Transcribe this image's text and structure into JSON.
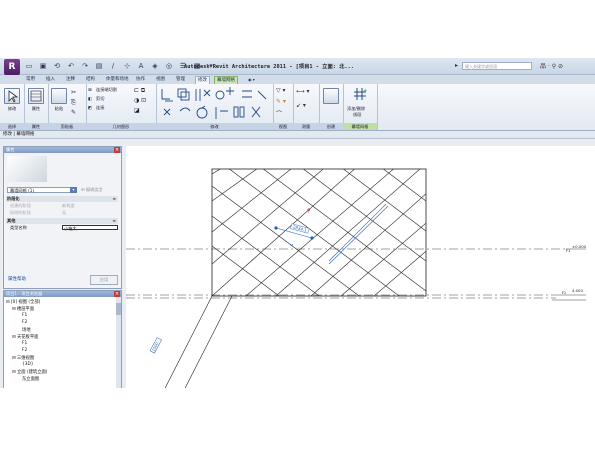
{
  "title": {
    "app_letter": "R",
    "text": "Autodesk Revit Architecture 2011 - [项目1 - 立面: 北...",
    "search_placeholder": "键入关键字或短语",
    "tools": "品 · ⚲ ⊘"
  },
  "tabs": [
    {
      "label": "常用",
      "state": "normal"
    },
    {
      "label": "插入",
      "state": "normal"
    },
    {
      "label": "注释",
      "state": "normal"
    },
    {
      "label": "结构",
      "state": "normal"
    },
    {
      "label": "体量和场地",
      "state": "normal"
    },
    {
      "label": "协作",
      "state": "normal"
    },
    {
      "label": "视图",
      "state": "normal"
    },
    {
      "label": "管理",
      "state": "normal"
    },
    {
      "label": "修改",
      "state": "active"
    },
    {
      "label": "幕墙网格",
      "state": "context"
    }
  ],
  "ribbon": {
    "panels": [
      {
        "title": "选择",
        "buttons": [
          "修改"
        ]
      },
      {
        "title": "属性",
        "buttons": [
          "属性"
        ]
      },
      {
        "title": "剪贴板",
        "buttons": [
          "粘贴"
        ]
      },
      {
        "title": "几何图形",
        "rows": [
          "连接端切割",
          "剪切",
          "连接"
        ]
      },
      {
        "title": "修改",
        "rows": []
      },
      {
        "title": "视图",
        "rows": []
      },
      {
        "title": "测量",
        "rows": []
      },
      {
        "title": "创建",
        "rows": []
      },
      {
        "title": "幕墙网格",
        "buttons": [
          "添加/删除",
          "线段"
        ]
      }
    ]
  },
  "command_bar": "修改 | 幕墙网格",
  "properties": {
    "header": "属性",
    "type_selector": "幕墙网格 (1)",
    "edit_type": "编辑类型",
    "groups": [
      {
        "name": "阶段化",
        "rows": [
          {
            "key": "创建的阶段",
            "value": "新构造",
            "grey": true
          },
          {
            "key": "拆除的阶段",
            "value": "无",
            "grey": true
          }
        ]
      },
      {
        "name": "其他",
        "rows": [
          {
            "key": "类型名称",
            "value": "小箱大",
            "grey": false,
            "boxed": true
          }
        ]
      }
    ],
    "help": "属性帮助",
    "apply": "应用"
  },
  "browser": {
    "header": "项目1 - 项目浏览器",
    "items": [
      {
        "text": "⊟ [0] 视图 (全部)",
        "level": 0
      },
      {
        "text": "⊟ 楼层平面",
        "level": 1
      },
      {
        "text": "F1",
        "level": 2
      },
      {
        "text": "F2",
        "level": 2
      },
      {
        "text": "场地",
        "level": 2
      },
      {
        "text": "⊟ 天花板平面",
        "level": 1
      },
      {
        "text": "F1",
        "level": 2
      },
      {
        "text": "F2",
        "level": 2
      },
      {
        "text": "⊟ 三维视图",
        "level": 1
      },
      {
        "text": "{3D}",
        "level": 2
      },
      {
        "text": "⊟ 立面 (建筑立面)",
        "level": 1
      },
      {
        "text": "东立面图",
        "level": 2
      }
    ]
  },
  "canvas": {
    "dimension_label": "2834.1",
    "slope_dimension": "1500",
    "level_1_value": "±0.000",
    "level_1_name": "F1",
    "level_2_value": "4.000",
    "level_2_name": "F2"
  },
  "colors": {
    "context_tab": "#c9e6b0",
    "selection_blue": "#1f5fbf",
    "grid_line": "#222222"
  }
}
